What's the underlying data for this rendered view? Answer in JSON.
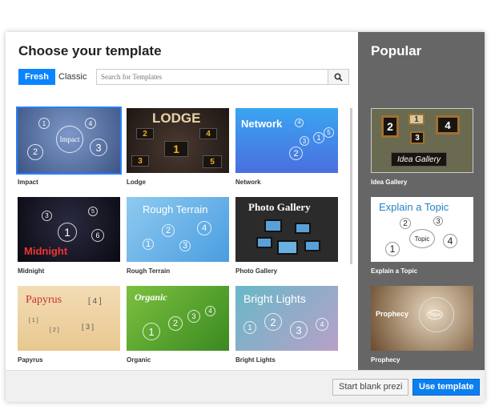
{
  "title": "Choose your template",
  "tabs": {
    "fresh": "Fresh",
    "classic": "Classic"
  },
  "search": {
    "placeholder": "Search for Templates",
    "icon": "search-icon"
  },
  "templates": [
    {
      "name": "Impact",
      "thumb_text": "Impact"
    },
    {
      "name": "Lodge",
      "thumb_text": "LODGE"
    },
    {
      "name": "Network",
      "thumb_text": "Network"
    },
    {
      "name": "Midnight",
      "thumb_text": "Midnight"
    },
    {
      "name": "Rough Terrain",
      "thumb_text": "Rough Terrain"
    },
    {
      "name": "Photo Gallery",
      "thumb_text": "Photo Gallery"
    },
    {
      "name": "Papyrus",
      "thumb_text": "Papyrus"
    },
    {
      "name": "Organic",
      "thumb_text": "Organic"
    },
    {
      "name": "Bright Lights",
      "thumb_text": "Bright Lights"
    }
  ],
  "popular": {
    "title": "Popular",
    "items": [
      {
        "name": "Idea Gallery",
        "thumb_text": "Idea Gallery"
      },
      {
        "name": "Explain a Topic",
        "thumb_text": "Explain a Topic",
        "center": "Topic"
      },
      {
        "name": "Prophecy",
        "thumb_text": "Prophecy",
        "center": "Topic"
      }
    ]
  },
  "footer": {
    "blank": "Start blank prezi",
    "use": "Use template"
  }
}
